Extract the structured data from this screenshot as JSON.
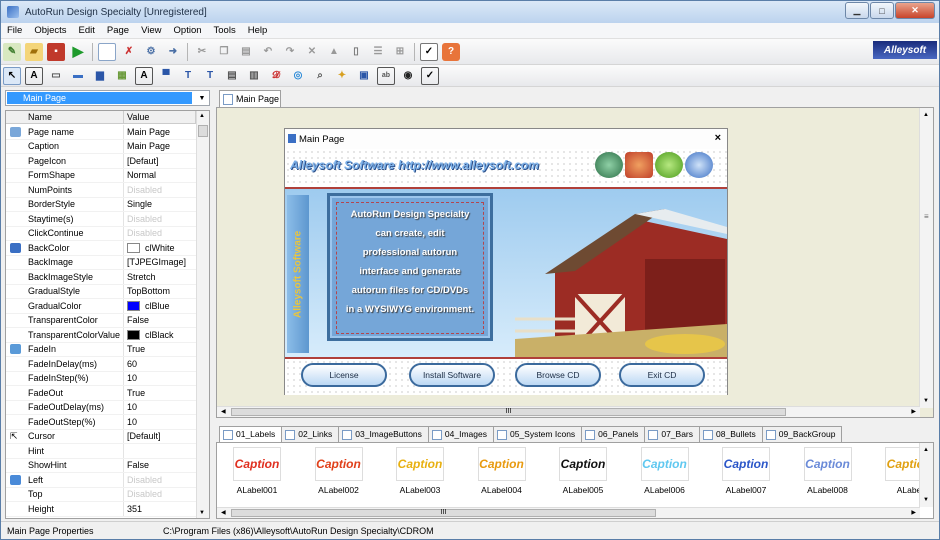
{
  "window": {
    "title": "AutoRun Design Specialty [Unregistered]"
  },
  "menu": [
    "File",
    "Objects",
    "Edit",
    "Page",
    "View",
    "Option",
    "Tools",
    "Help"
  ],
  "brand": "Alleysoft",
  "object_selector": "Main Page",
  "grid": {
    "col_name": "Name",
    "col_value": "Value",
    "rows": [
      {
        "name": "Page name",
        "value": "Main Page"
      },
      {
        "name": "Caption",
        "value": "Main Page"
      },
      {
        "name": "PageIcon",
        "value": "[Defaut]"
      },
      {
        "name": "FormShape",
        "value": "Normal"
      },
      {
        "name": "NumPoints",
        "value": "Disabled"
      },
      {
        "name": "BorderStyle",
        "value": "Single"
      },
      {
        "name": "Staytime(s)",
        "value": "Disabled"
      },
      {
        "name": "ClickContinue",
        "value": "Disabled"
      },
      {
        "name": "BackColor",
        "value": "clWhite"
      },
      {
        "name": "BackImage",
        "value": "[TJPEGImage]"
      },
      {
        "name": "BackImageStyle",
        "value": "Stretch"
      },
      {
        "name": "GradualStyle",
        "value": "TopBottom"
      },
      {
        "name": "GradualColor",
        "value": "clBlue"
      },
      {
        "name": "TransparentColor",
        "value": "False"
      },
      {
        "name": "TransparentColorValue",
        "value": "clBlack"
      },
      {
        "name": "FadeIn",
        "value": "True"
      },
      {
        "name": "FadeInDelay(ms)",
        "value": "60"
      },
      {
        "name": "FadeInStep(%)",
        "value": "10"
      },
      {
        "name": "FadeOut",
        "value": "True"
      },
      {
        "name": "FadeOutDelay(ms)",
        "value": "10"
      },
      {
        "name": "FadeOutStep(%)",
        "value": "10"
      },
      {
        "name": "Cursor",
        "value": "[Default]"
      },
      {
        "name": "Hint",
        "value": ""
      },
      {
        "name": "ShowHint",
        "value": "False"
      },
      {
        "name": "Left",
        "value": "Disabled"
      },
      {
        "name": "Top",
        "value": "Disabled"
      },
      {
        "name": "Height",
        "value": "351"
      }
    ]
  },
  "page_tab": "Main Page",
  "child": {
    "caption": "Main Page",
    "close": "×",
    "banner": "Alleysoft Software http://www.alleysoft.com",
    "side_text": "Alleysoft Software",
    "body_lines": [
      "AutoRun Design Specialty",
      "can create, edit",
      "professional autorun",
      "interface and generate",
      "autorun files for CD/DVDs",
      "in a WYSIWYG environment."
    ],
    "buttons": [
      "License",
      "Install Software",
      "Browse CD",
      "Exit CD"
    ]
  },
  "scroll_grip": "III",
  "bottom_tabs": [
    "01_Labels",
    "02_Links",
    "03_ImageButtons",
    "04_Images",
    "05_System Icons",
    "06_Panels",
    "07_Bars",
    "08_Bullets",
    "09_BackGroup"
  ],
  "gallery": {
    "caption_text": "Caption",
    "items": [
      "ALabel001",
      "ALabel002",
      "ALabel003",
      "ALabel004",
      "ALabel005",
      "ALabel006",
      "ALabel007",
      "ALabel008",
      "ALabe"
    ]
  },
  "status": {
    "left": "Main Page Properties",
    "right": "C:\\Program Files (x86)\\Alleysoft\\AutoRun Design Specialty\\CDROM"
  }
}
